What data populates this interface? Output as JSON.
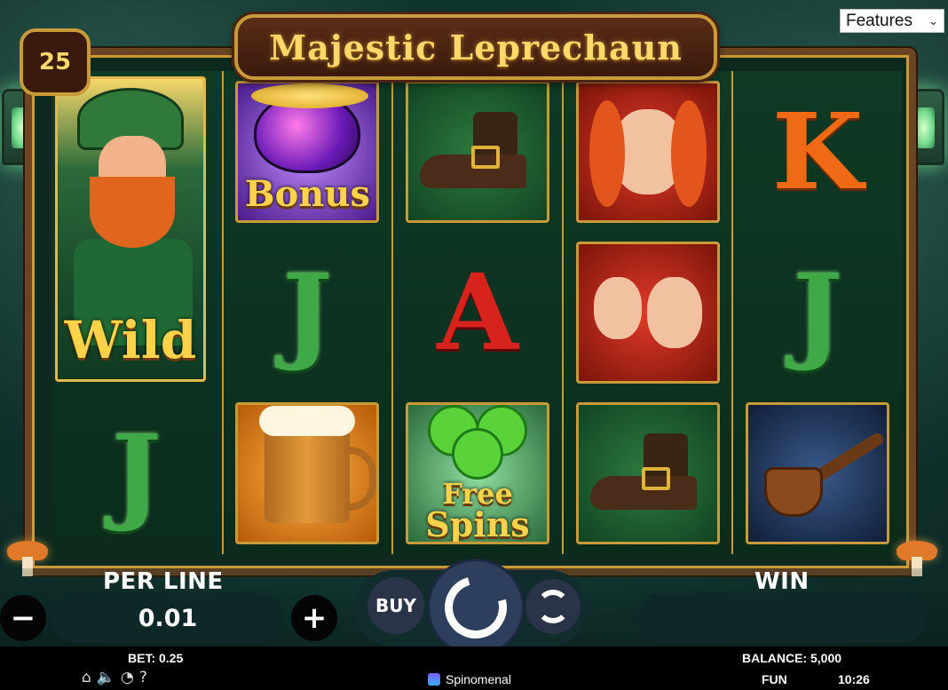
{
  "game": {
    "title": "Majestic Leprechaun",
    "lines": "25"
  },
  "features_menu": {
    "selected": "Features"
  },
  "reels": {
    "wild_label": "Wild",
    "bonus_label": "Bonus",
    "free_spins_line1": "Free",
    "free_spins_line2": "Spins",
    "letters": {
      "r2": "J",
      "r3": "A",
      "r5_top": "K",
      "r5_mid": "J",
      "r1_bottom": "J"
    }
  },
  "controls": {
    "per_line_label": "PER LINE",
    "per_line_value": "0.01",
    "minus": "−",
    "plus": "+",
    "buy_label": "BUY",
    "win_label": "WIN"
  },
  "status": {
    "bet": "BET:  0.25",
    "balance": "BALANCE:  5,000",
    "brand": "Spinomenal",
    "mode": "FUN",
    "clock": "10:26"
  },
  "icons": [
    "home-icon",
    "sound-icon",
    "speed-icon",
    "help-icon"
  ],
  "colors": {
    "frame_gold": "#c99a3a",
    "frame_wood": "#6b4423",
    "reel_bg": "#0f3a24",
    "control_field": "#0e2828",
    "spin_button": "#2d3f5c"
  }
}
